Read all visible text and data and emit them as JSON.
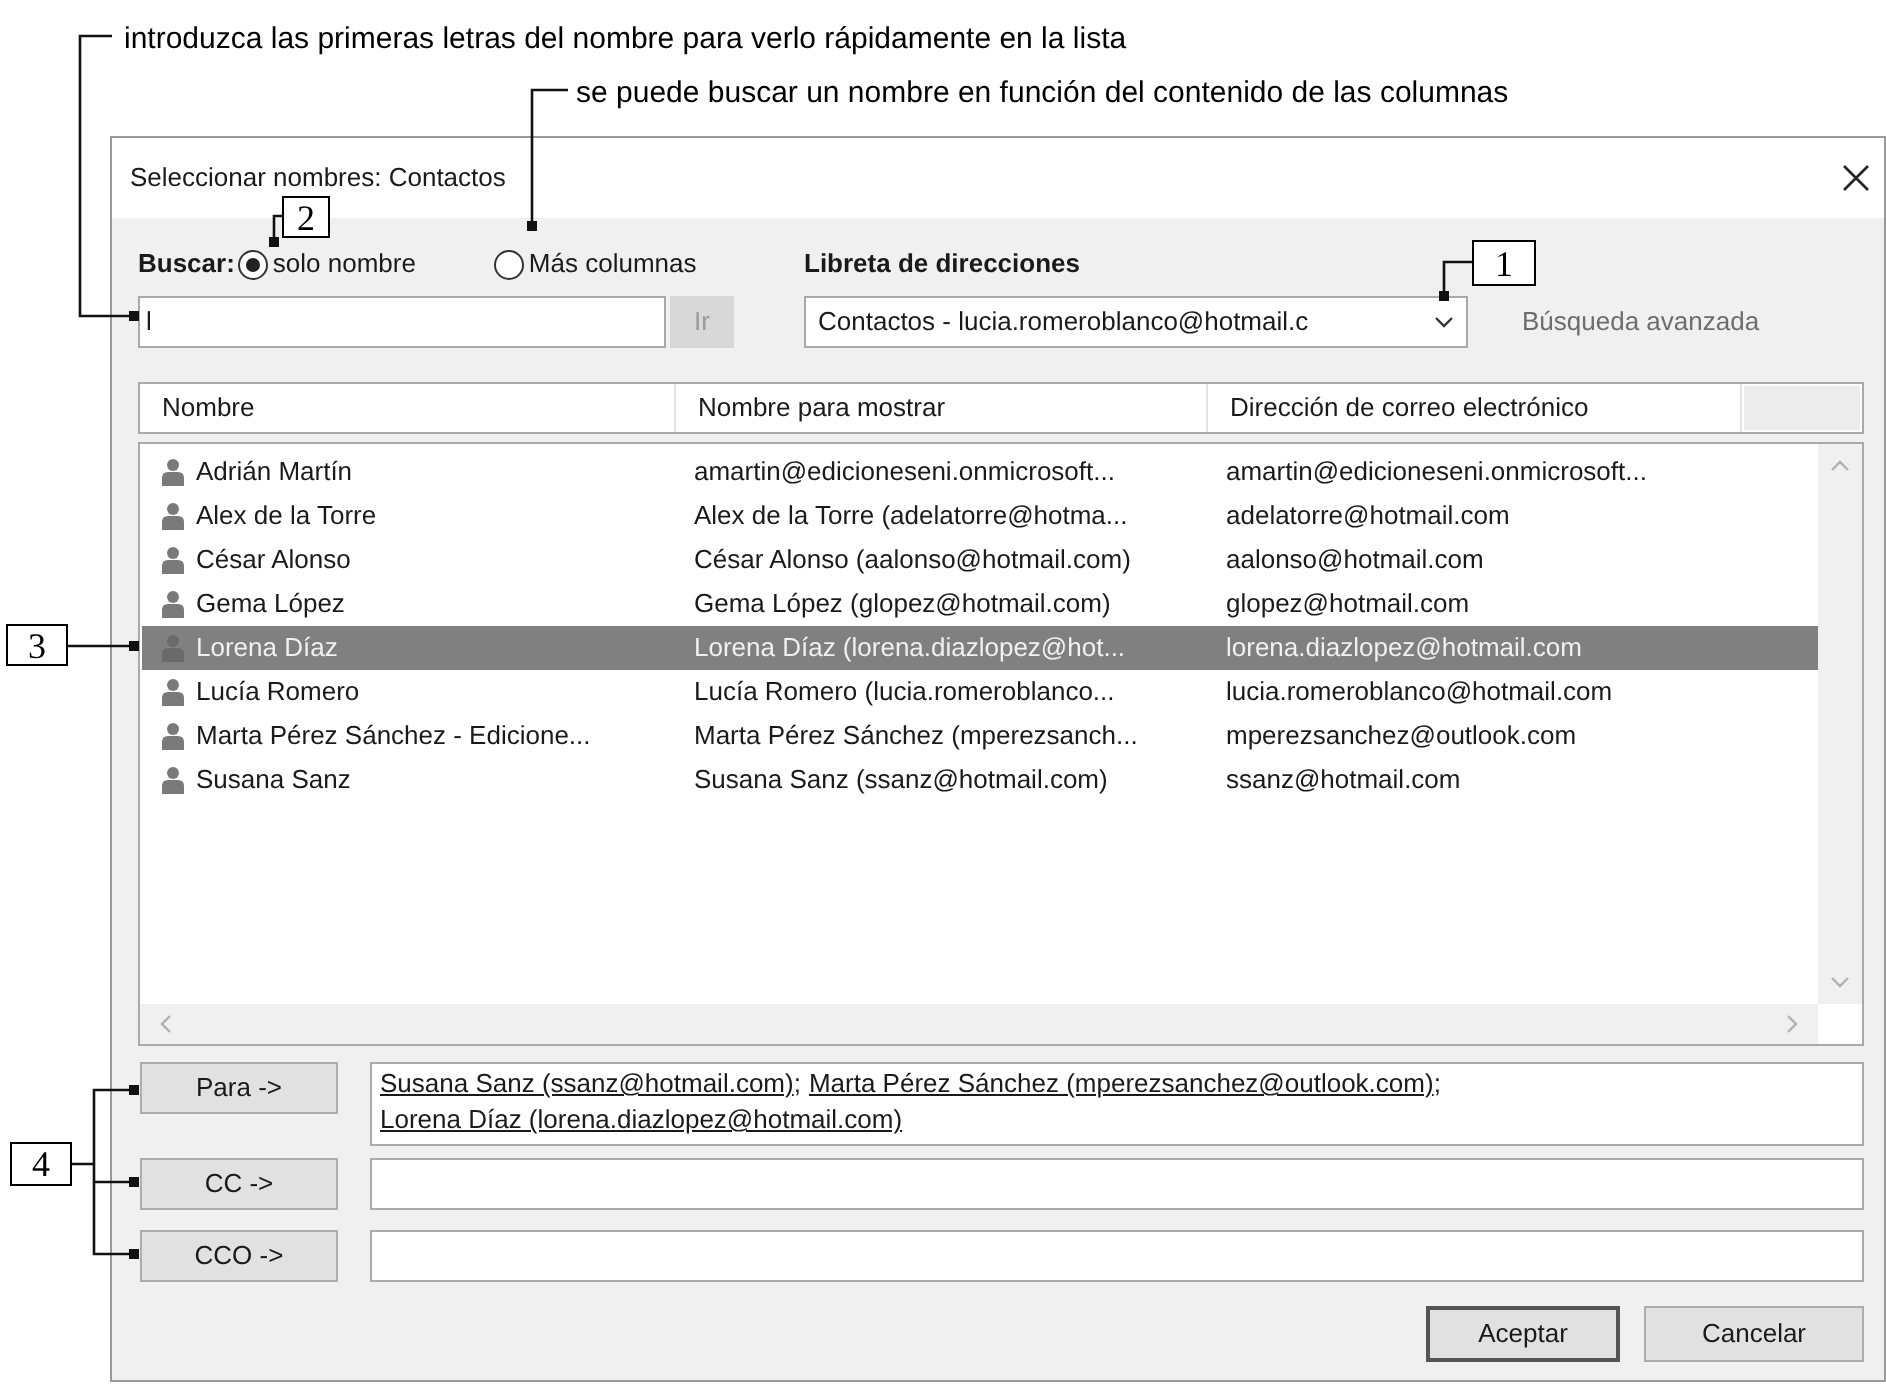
{
  "annotations": [
    {
      "text": "introduzca las primeras letras del nombre para verlo rápidamente en la lista"
    },
    {
      "text": "se puede buscar un nombre en función del contenido de las columnas"
    }
  ],
  "callout_numbers": [
    "1",
    "2",
    "3",
    "4"
  ],
  "window": {
    "title": "Seleccionar nombres: Contactos"
  },
  "search": {
    "label": "Buscar:",
    "options": [
      {
        "label": "solo nombre",
        "selected": true
      },
      {
        "label": "Más columnas",
        "selected": false
      }
    ],
    "value": "l",
    "go_button": {
      "label": "Ir",
      "disabled": true
    }
  },
  "address_book": {
    "label": "Libreta de direcciones",
    "value": "Contactos - lucia.romeroblanco@hotmail.c",
    "advanced": {
      "label": "Búsqueda avanzada",
      "disabled": true
    }
  },
  "table": {
    "columns": [
      "Nombre",
      "Nombre para mostrar",
      "Dirección de correo electrónico"
    ],
    "rows": [
      {
        "name": "Adrián Martín",
        "display": "amartin@edicioneseni.onmicrosoft...",
        "email": "amartin@edicioneseni.onmicrosoft...",
        "selected": false
      },
      {
        "name": "Alex de la Torre",
        "display": "Alex de la Torre (adelatorre@hotma...",
        "email": "adelatorre@hotmail.com",
        "selected": false
      },
      {
        "name": "César Alonso",
        "display": "César Alonso (aalonso@hotmail.com)",
        "email": "aalonso@hotmail.com",
        "selected": false
      },
      {
        "name": "Gema López",
        "display": "Gema López (glopez@hotmail.com)",
        "email": "glopez@hotmail.com",
        "selected": false
      },
      {
        "name": "Lorena Díaz",
        "display": "Lorena Díaz (lorena.diazlopez@hot...",
        "email": "lorena.diazlopez@hotmail.com",
        "selected": true
      },
      {
        "name": "Lucía Romero",
        "display": "Lucía Romero (lucia.romeroblanco...",
        "email": "lucia.romeroblanco@hotmail.com",
        "selected": false
      },
      {
        "name": "Marta Pérez Sánchez - Edicione...",
        "display": "Marta Pérez Sánchez (mperezsanch...",
        "email": "mperezsanchez@outlook.com",
        "selected": false
      },
      {
        "name": "Susana Sanz",
        "display": "Susana Sanz (ssanz@hotmail.com)",
        "email": "ssanz@hotmail.com",
        "selected": false
      }
    ]
  },
  "recipients": [
    {
      "button": "Para ->",
      "separator": ";",
      "entries": [
        "Susana Sanz (ssanz@hotmail.com)",
        "Marta Pérez Sánchez (mperezsanchez@outlook.com)",
        "Lorena Díaz (lorena.diazlopez@hotmail.com)"
      ]
    },
    {
      "button": "CC ->"
    },
    {
      "button": "CCO ->"
    }
  ],
  "buttons": [
    {
      "label": "Aceptar",
      "default": true
    },
    {
      "label": "Cancelar",
      "default": false
    }
  ]
}
